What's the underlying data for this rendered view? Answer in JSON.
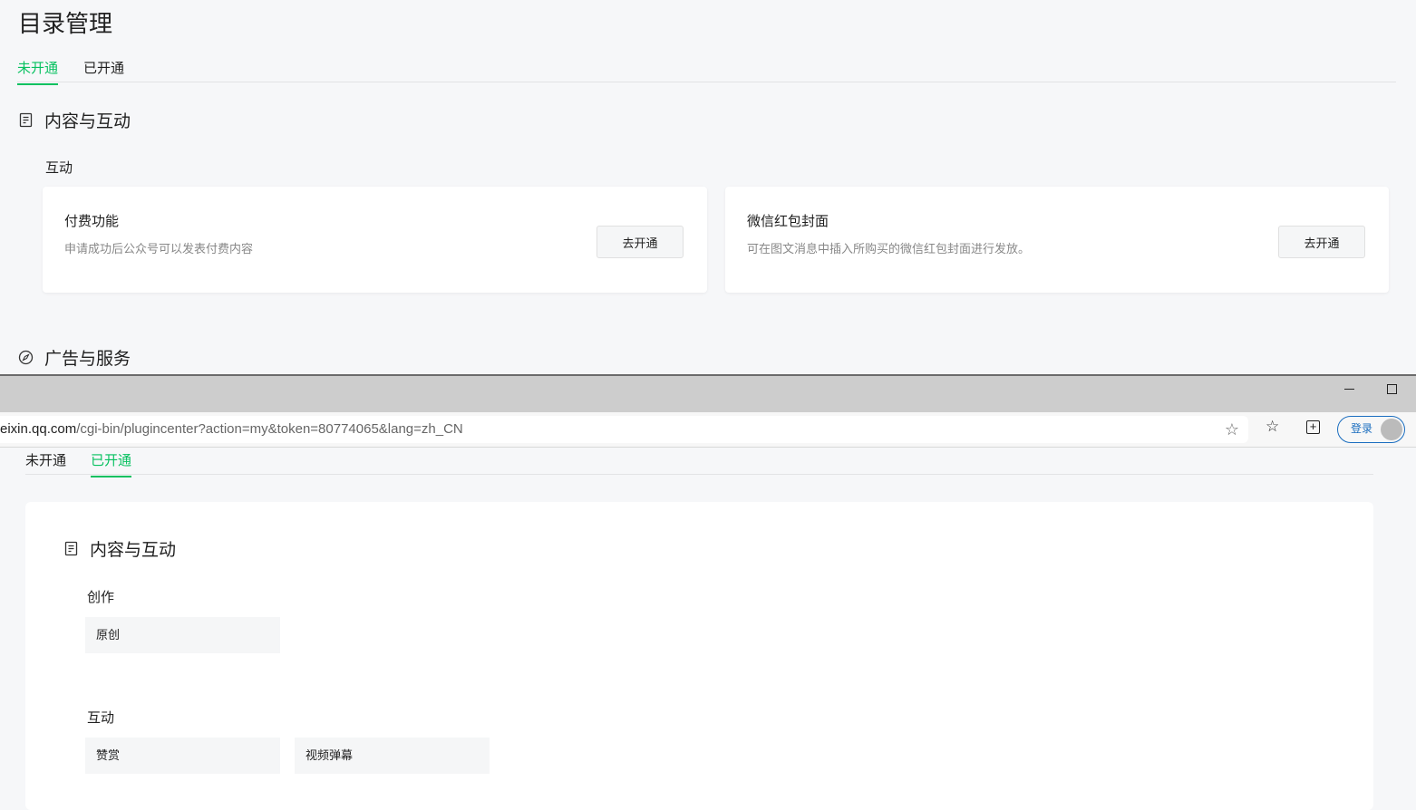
{
  "top": {
    "title": "目录管理",
    "tabs": [
      "未开通",
      "已开通"
    ],
    "section1": "内容与互动",
    "sub1": "互动",
    "cards": [
      {
        "title": "付费功能",
        "desc": "申请成功后公众号可以发表付费内容",
        "button": "去开通"
      },
      {
        "title": "微信红包封面",
        "desc": "可在图文消息中插入所购买的微信红包封面进行发放。",
        "button": "去开通"
      }
    ],
    "section2": "广告与服务"
  },
  "browser": {
    "url_host": "eixin.qq.com",
    "url_path": "/cgi-bin/plugincenter?action=my&token=80774065&lang=zh_CN",
    "login": "登录"
  },
  "bottom": {
    "tabs": [
      "未开通",
      "已开通"
    ],
    "section": "内容与互动",
    "groups": [
      {
        "label": "创作",
        "items": [
          "原创"
        ]
      },
      {
        "label": "互动",
        "items": [
          "赞赏",
          "视频弹幕"
        ]
      }
    ]
  }
}
